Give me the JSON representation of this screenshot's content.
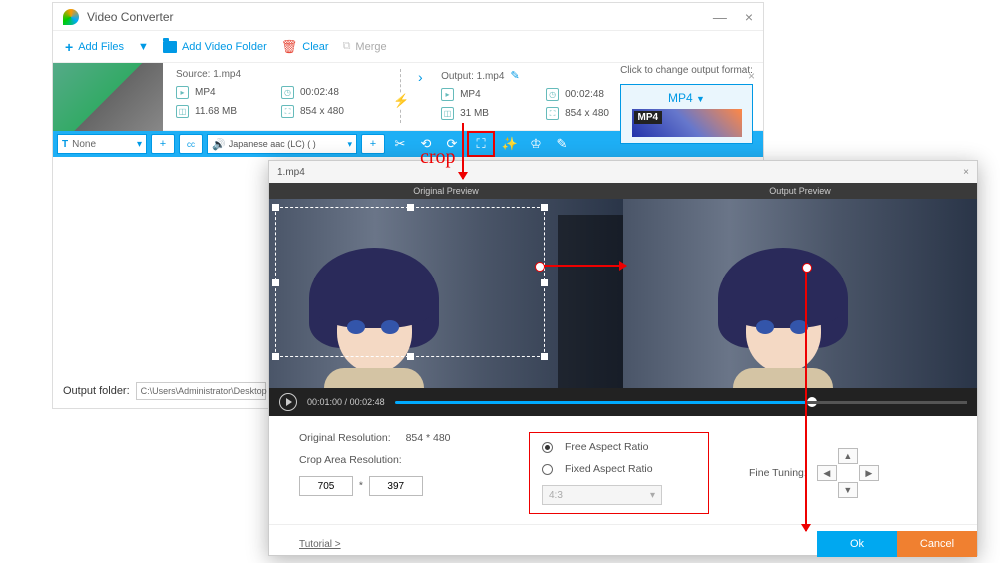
{
  "app": {
    "title": "Video Converter"
  },
  "toolbar": {
    "add_files": "Add Files",
    "add_folder": "Add Video Folder",
    "clear": "Clear",
    "merge": "Merge"
  },
  "file": {
    "source_label": "Source: 1.mp4",
    "output_label": "Output: 1.mp4",
    "src": {
      "format": "MP4",
      "duration": "00:02:48",
      "size": "11.68 MB",
      "res": "854 x 480"
    },
    "out": {
      "format": "MP4",
      "duration": "00:02:48",
      "size": "31 MB",
      "res": "854 x 480"
    }
  },
  "bluebar": {
    "subtitle": "None",
    "audio": "Japanese aac (LC) (  )"
  },
  "sidebar": {
    "label": "Click to change output format:",
    "format": "MP4",
    "badge": "MP4"
  },
  "footer": {
    "label": "Output folder:",
    "path": "C:\\Users\\Administrator\\Desktop"
  },
  "crop": {
    "file": "1.mp4",
    "orig_hdr": "Original Preview",
    "out_hdr": "Output Preview",
    "time_current": "00:01:00",
    "time_total": "00:02:48",
    "orig_res_label": "Original Resolution:",
    "orig_res": "854 * 480",
    "area_label": "Crop Area Resolution:",
    "w": "705",
    "h": "397",
    "free": "Free Aspect Ratio",
    "fixed": "Fixed Aspect Ratio",
    "ratio_sel": "4:3",
    "fine": "Fine Tuning:",
    "tutorial": "Tutorial >",
    "ok": "Ok",
    "cancel": "Cancel"
  },
  "annot": {
    "crop": "crop"
  }
}
